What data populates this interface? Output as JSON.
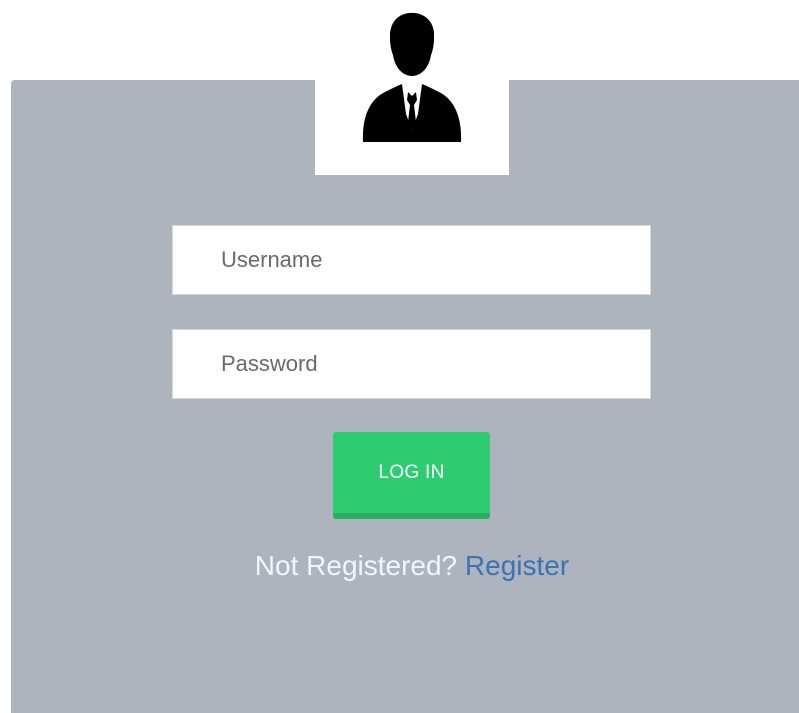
{
  "login_form": {
    "username_placeholder": "Username",
    "password_placeholder": "Password",
    "login_button_label": "LOG IN",
    "register_prompt": "Not Registered?",
    "register_link_label": "Register"
  },
  "icons": {
    "avatar": "user-avatar-icon"
  },
  "colors": {
    "panel_background": "#adb4be",
    "login_button": "#2ecc71",
    "login_button_shadow": "#27ae60",
    "register_link": "#3b73b4"
  }
}
